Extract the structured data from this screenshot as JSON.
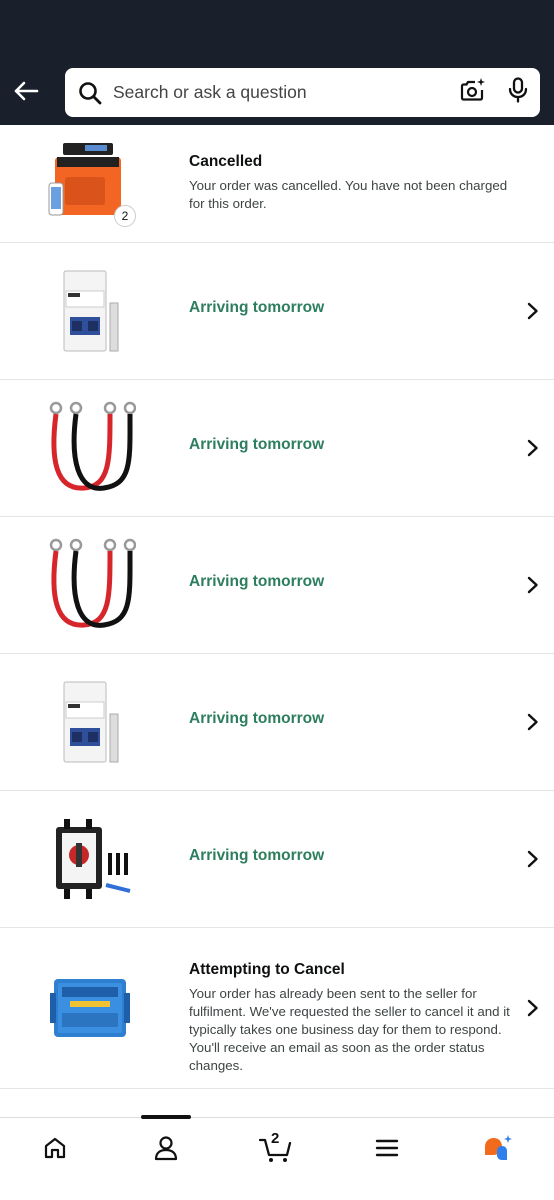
{
  "search": {
    "placeholder": "Search or ask a question"
  },
  "orders": [
    {
      "status": "Cancelled",
      "description": "Your order was cancelled. You have not been charged for this order.",
      "quantity": "2",
      "product_icon": "portable-power-station"
    },
    {
      "status": "Arriving tomorrow",
      "product_icon": "circuit-breaker"
    },
    {
      "status": "Arriving tomorrow",
      "product_icon": "battery-cables"
    },
    {
      "status": "Arriving tomorrow",
      "product_icon": "battery-cables"
    },
    {
      "status": "Arriving tomorrow",
      "product_icon": "circuit-breaker"
    },
    {
      "status": "Arriving tomorrow",
      "product_icon": "pv-isolator-switch"
    },
    {
      "status": "Attempting to Cancel",
      "description": "Your order has already been sent to the seller for fulfilment. We've requested the seller to cancel it and it typically takes one business day for them to respond. You'll receive an email as soon as the order status changes.",
      "product_icon": "solar-charge-controller"
    }
  ],
  "bottom_nav": {
    "cart_count": "2",
    "items": [
      "home-icon",
      "account-icon",
      "cart-icon",
      "menu-icon",
      "rufus-assistant-icon"
    ]
  },
  "colors": {
    "header_bg": "#1a202b",
    "status_green": "#2d7e5e"
  }
}
